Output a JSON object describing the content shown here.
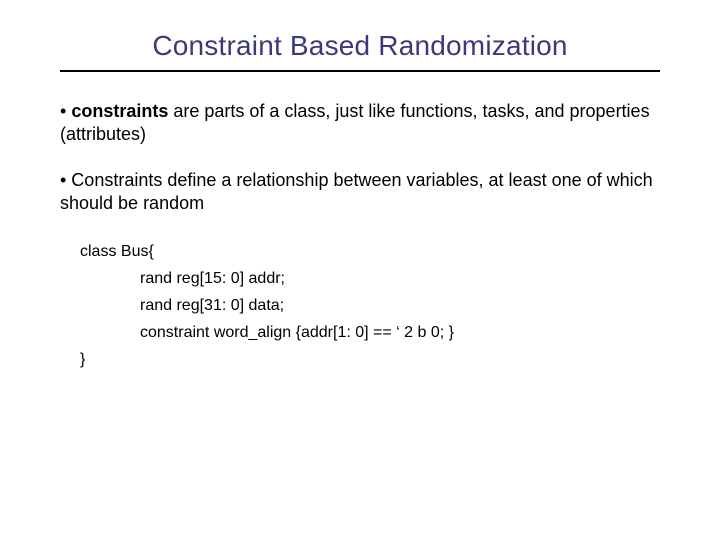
{
  "title": "Constraint Based Randomization",
  "bullets": {
    "b1_prefix": "• ",
    "b1_bold": "constraints",
    "b1_rest": " are parts of a class, just like functions, tasks, and properties (attributes)",
    "b2": "• Constraints define a relationship between variables, at least one of which should be random"
  },
  "code": {
    "l0": "class Bus{",
    "l1": "rand reg[15: 0] addr;",
    "l2": "rand reg[31: 0] data;",
    "l3": "constraint word_align {addr[1: 0] == ‘ 2 b 0; }",
    "l4": "}"
  }
}
